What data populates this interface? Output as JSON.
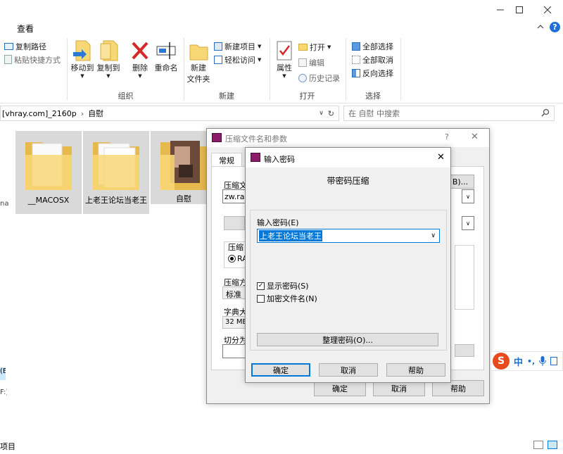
{
  "ribbon": {
    "tab_view": "查看",
    "clipboard": {
      "copy_path": "复制路径",
      "paste_shortcut": "粘贴快捷方式"
    },
    "organize": {
      "move_to": "移动到",
      "copy_to": "复制到",
      "delete": "删除",
      "rename": "重命名",
      "label": "组织"
    },
    "new": {
      "new_folder_l1": "新建",
      "new_folder_l2": "文件夹",
      "new_item": "新建项目",
      "easy_access": "轻松访问",
      "label": "新建"
    },
    "open": {
      "properties": "属性",
      "open": "打开",
      "edit": "编辑",
      "history": "历史记录",
      "label": "打开"
    },
    "select": {
      "select_all": "全部选择",
      "select_none": "全部取消",
      "invert": "反向选择",
      "label": "选择"
    }
  },
  "address": {
    "path_part1": "[vhray.com]_2160p",
    "path_part2": "自慰",
    "search_placeholder": "在 自慰 中搜索"
  },
  "folders": [
    {
      "name": "__MACOSX"
    },
    {
      "name": "上老王论坛当老王"
    },
    {
      "name": "自慰"
    }
  ],
  "left_edge": {
    "frag1": "na",
    "frag2": "(E",
    "frag3": "F:)"
  },
  "status": {
    "items": "项目"
  },
  "archive_dialog": {
    "title": "压缩文件名和参数",
    "help": "?",
    "tab_general": "常规",
    "archive_name_label": "压缩文",
    "archive_name_value": "zw.rar",
    "browse_btn": "B)...",
    "format_label": "压缩",
    "format_rar": "RA",
    "method_label": "压缩方",
    "method_value": "标准",
    "dict_label": "字典大",
    "dict_value": "32 MB",
    "split_label": "切分为",
    "ok": "确定",
    "cancel": "取消",
    "help_btn": "帮助"
  },
  "password_dialog": {
    "title": "输入密码",
    "heading": "带密码压缩",
    "enter_label": "输入密码(E)",
    "password_value": "上老王论坛当老王",
    "show_password": "显示密码(S)",
    "show_password_checked": true,
    "encrypt_names": "加密文件名(N)",
    "encrypt_names_checked": false,
    "organize_btn": "整理密码(O)...",
    "ok": "确定",
    "cancel": "取消",
    "help": "帮助"
  },
  "ime": {
    "lang": "中",
    "punct": "•,"
  },
  "colors": {
    "accent": "#0078d7",
    "selection": "#cce8ff",
    "folder": "#f8d775",
    "sogou": "#e8491d"
  }
}
